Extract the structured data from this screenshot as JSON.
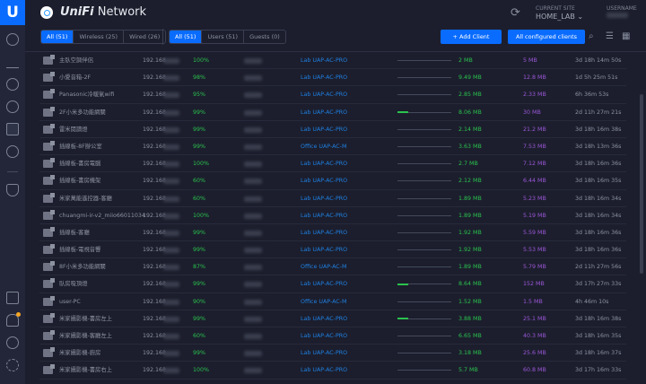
{
  "app": {
    "logo": "U",
    "title_brand": "UniFi",
    "title_rest": "Network"
  },
  "site": {
    "label": "CURRENT SITE",
    "value": "HOME_LAB",
    "user_label": "USERNAME"
  },
  "filters": {
    "conn": [
      {
        "label": "All (51)",
        "active": true
      },
      {
        "label": "Wireless (25)"
      },
      {
        "label": "Wired (26)"
      }
    ],
    "type": [
      {
        "label": "All (51)",
        "active": true
      },
      {
        "label": "Users (51)"
      },
      {
        "label": "Guests (0)"
      }
    ]
  },
  "buttons": {
    "add_client": "+ Add Client",
    "all_configured": "All configured clients"
  },
  "accent": "#0a6cff",
  "clients": [
    {
      "name": "主臥空調伴侶",
      "ip": "192.168",
      "signal": "100%",
      "ap": "Lab UAP-AC-PRO",
      "activity": 0,
      "down": "2 MB",
      "up": "5 MB",
      "uptime": "3d 18h 14m 50s"
    },
    {
      "name": "小愛音箱-2F",
      "ip": "192.168",
      "signal": "98%",
      "ap": "Lab UAP-AC-PRO",
      "activity": 0,
      "down": "9.49 MB",
      "up": "12.8 MB",
      "uptime": "1d 5h 25m 51s"
    },
    {
      "name": "Panasonic冷暖氣wifi",
      "ip": "192.168",
      "signal": "95%",
      "ap": "Lab UAP-AC-PRO",
      "activity": 0,
      "down": "2.85 MB",
      "up": "2.33 MB",
      "uptime": "6h 36m 53s"
    },
    {
      "name": "2F小米多功能網關",
      "ip": "192.168",
      "signal": "99%",
      "ap": "Lab UAP-AC-PRO",
      "activity": 20,
      "down": "8.06 MB",
      "up": "30 MB",
      "uptime": "2d 11h 27m 21s"
    },
    {
      "name": "雷米閱讀燈",
      "ip": "192.168",
      "signal": "99%",
      "ap": "Lab UAP-AC-PRO",
      "activity": 0,
      "down": "2.14 MB",
      "up": "21.2 MB",
      "uptime": "3d 18h 16m 38s"
    },
    {
      "name": "插線板-8F辦公室",
      "ip": "192.168",
      "signal": "99%",
      "ap": "Office UAP-AC-M",
      "activity": 0,
      "down": "3.63 MB",
      "up": "7.53 MB",
      "uptime": "3d 18h 13m 36s"
    },
    {
      "name": "插線板-書房電腦",
      "ip": "192.168",
      "signal": "100%",
      "ap": "Lab UAP-AC-PRO",
      "activity": 0,
      "down": "2.7 MB",
      "up": "7.12 MB",
      "uptime": "3d 18h 16m 36s"
    },
    {
      "name": "插線板-書房機架",
      "ip": "192.168",
      "signal": "60%",
      "ap": "Lab UAP-AC-PRO",
      "activity": 0,
      "down": "2.12 MB",
      "up": "6.44 MB",
      "uptime": "3d 18h 16m 35s"
    },
    {
      "name": "米家萬能遙控器-客廳",
      "ip": "192.168",
      "signal": "60%",
      "ap": "Lab UAP-AC-PRO",
      "activity": 0,
      "down": "1.89 MB",
      "up": "5.23 MB",
      "uptime": "3d 18h 16m 34s"
    },
    {
      "name": "chuangmi-ir-v2_miio66011034",
      "ip": "192.168",
      "signal": "100%",
      "ap": "Lab UAP-AC-PRO",
      "activity": 0,
      "down": "1.89 MB",
      "up": "5.19 MB",
      "uptime": "3d 18h 16m 34s"
    },
    {
      "name": "插線板-客廳",
      "ip": "192.168",
      "signal": "99%",
      "ap": "Lab UAP-AC-PRO",
      "activity": 0,
      "down": "1.92 MB",
      "up": "5.59 MB",
      "uptime": "3d 18h 16m 36s"
    },
    {
      "name": "插線板-電視音響",
      "ip": "192.168",
      "signal": "99%",
      "ap": "Lab UAP-AC-PRO",
      "activity": 0,
      "down": "1.92 MB",
      "up": "5.53 MB",
      "uptime": "3d 18h 16m 36s"
    },
    {
      "name": "8F小米多功能網關",
      "ip": "192.168",
      "signal": "87%",
      "ap": "Office UAP-AC-M",
      "activity": 0,
      "down": "1.89 MB",
      "up": "5.79 MB",
      "uptime": "2d 11h 27m 56s"
    },
    {
      "name": "臥房吸頂燈",
      "ip": "192.168",
      "signal": "99%",
      "ap": "Lab UAP-AC-PRO",
      "activity": 20,
      "down": "8.64 MB",
      "up": "152 MB",
      "uptime": "3d 17h 27m 33s"
    },
    {
      "name": "user-PC",
      "ip": "192.168",
      "signal": "90%",
      "ap": "Office UAP-AC-M",
      "activity": 0,
      "down": "1.52 MB",
      "up": "1.5 MB",
      "uptime": "4h 46m 10s"
    },
    {
      "name": "米家攝影機-書房左上",
      "ip": "192.168",
      "signal": "99%",
      "ap": "Lab UAP-AC-PRO",
      "activity": 20,
      "down": "3.88 MB",
      "up": "25.1 MB",
      "uptime": "3d 18h 16m 38s"
    },
    {
      "name": "米家攝影機-客廳左上",
      "ip": "192.168",
      "signal": "60%",
      "ap": "Lab UAP-AC-PRO",
      "activity": 0,
      "down": "6.65 MB",
      "up": "40.3 MB",
      "uptime": "3d 18h 16m 35s"
    },
    {
      "name": "米家攝影機-廚房",
      "ip": "192.168",
      "signal": "99%",
      "ap": "Lab UAP-AC-PRO",
      "activity": 0,
      "down": "3.18 MB",
      "up": "25.6 MB",
      "uptime": "3d 18h 16m 37s"
    },
    {
      "name": "米家攝影機-書房右上",
      "ip": "192.168",
      "signal": "100%",
      "ap": "Lab UAP-AC-PRO",
      "activity": 0,
      "down": "5.7 MB",
      "up": "60.8 MB",
      "uptime": "3d 17h 16m 33s"
    }
  ]
}
